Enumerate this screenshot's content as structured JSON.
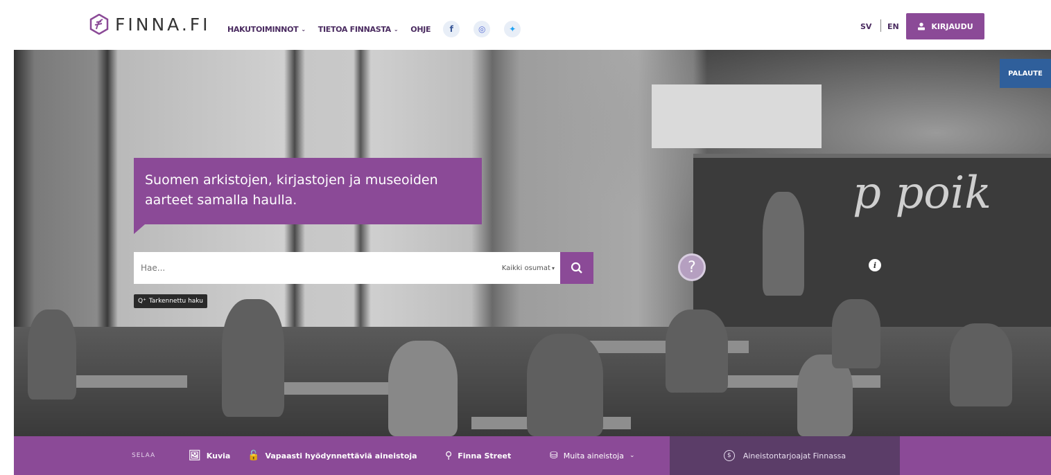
{
  "header": {
    "logo_text": "FINNA.FI",
    "nav": [
      {
        "label": "HAKUTOIMINNOT",
        "dropdown": true
      },
      {
        "label": "TIETOA FINNASTA",
        "dropdown": true
      },
      {
        "label": "OHJE",
        "dropdown": false
      }
    ],
    "social": [
      {
        "icon": "facebook-icon",
        "glyph": "f"
      },
      {
        "icon": "instagram-icon",
        "glyph": "◎"
      },
      {
        "icon": "twitter-icon",
        "glyph": "✦"
      }
    ],
    "lang_sv": "SV",
    "lang_en": "EN",
    "login_label": "KIRJAUDU"
  },
  "hero": {
    "tagline": "Suomen arkistojen, kirjastojen ja museoiden aarteet samalla haulla.",
    "search_placeholder": "Hae...",
    "scope_label": "Kaikki osumat",
    "advanced_label": "Tarkennettu haku",
    "feedback_label": "PALAUTE",
    "help_glyph": "?",
    "info_glyph": "i"
  },
  "browse": {
    "label": "SELAA",
    "items": [
      {
        "label": "Kuvia",
        "icon": "image-icon"
      },
      {
        "label": "Vapaasti hyödynnettäviä aineistoja",
        "icon": "open-lock-icon"
      },
      {
        "label": "Finna Street",
        "icon": "map-pin-icon"
      },
      {
        "label": "Muita aineistoja",
        "icon": "box-icon"
      }
    ],
    "providers_label": "Aineistontarjoajat Finnassa"
  },
  "colors": {
    "brand_purple": "#8b4a97",
    "dark_purple": "#5b3d68",
    "feedback_blue": "#2f5f9b"
  }
}
